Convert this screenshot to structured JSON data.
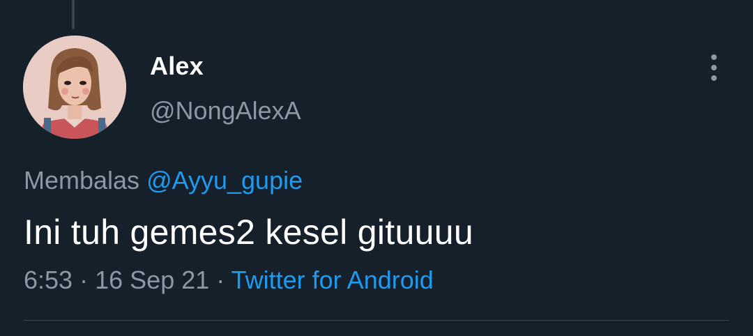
{
  "tweet": {
    "author": {
      "display_name": "Alex",
      "handle": "@NongAlexA"
    },
    "reply": {
      "prefix": "Membalas",
      "mention": "@Ayyu_gupie"
    },
    "text": "Ini tuh gemes2 kesel gituuuu",
    "meta": {
      "time": "6:53",
      "separator": "·",
      "date": "16 Sep 21",
      "source": "Twitter for Android"
    }
  },
  "icons": {
    "more": "more-vertical-icon",
    "avatar": "avatar-illustration"
  },
  "colors": {
    "background": "#15202b",
    "primary_text": "#ffffff",
    "secondary_text": "#8b98a5",
    "link": "#1d9bf0",
    "divider": "#38444d"
  }
}
